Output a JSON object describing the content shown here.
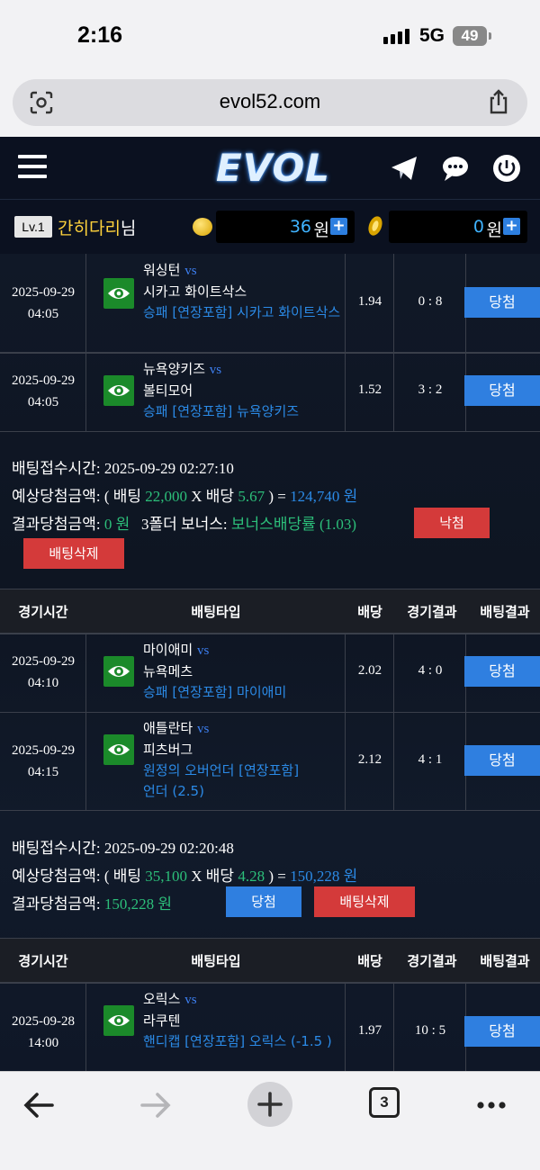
{
  "status": {
    "time": "2:16",
    "network": "5G",
    "battery": "49"
  },
  "browser": {
    "url": "evol52.com",
    "tab_count": "3"
  },
  "header": {
    "logo": "EVOL"
  },
  "user": {
    "level": "Lv.1",
    "name": "간히다리",
    "suffix": "님",
    "balance": "36",
    "balance_unit": "원",
    "points": "0",
    "points_unit": "원"
  },
  "table_headers": {
    "time": "경기시간",
    "type": "배팅타입",
    "odds": "배당",
    "result": "경기결과",
    "bet_result": "배팅결과"
  },
  "slip1": {
    "rows": [
      {
        "date": "2025-09-29",
        "time": "04:05",
        "team1": "워싱턴",
        "vs": "vs",
        "team2": "시카고 화이트삭스",
        "bet": "승패 [연장포함] 시카고 화이트삭스",
        "odds": "1.94",
        "score": "0 : 8",
        "status": "당첨"
      },
      {
        "date": "2025-09-29",
        "time": "04:05",
        "team1": "뉴욕양키즈",
        "vs": "vs",
        "team2": "볼티모어",
        "bet": "승패 [연장포함] 뉴욕양키즈",
        "odds": "1.52",
        "score": "3 : 2",
        "status": "당첨"
      }
    ],
    "accept_label": "배팅접수시간:",
    "accept_time": "2025-09-29 02:27:10",
    "expected_label": "예상당첨금액: ( 배팅",
    "bet_amount": "22,000",
    "x_label": "X 배당",
    "odds_total": "5.67",
    "eq": ") =",
    "expected_amount": "124,740 원",
    "result_label": "결과당첨금액:",
    "result_amount": "0 원",
    "bonus_label": "3폴더 보너스:",
    "bonus_value": "보너스배당률 (1.03)",
    "status_button": "낙첨",
    "delete_button": "배팅삭제"
  },
  "slip2": {
    "rows": [
      {
        "date": "2025-09-29",
        "time": "04:10",
        "team1": "마이애미",
        "vs": "vs",
        "team2": "뉴욕메츠",
        "bet": "승패 [연장포함] 마이애미",
        "odds": "2.02",
        "score": "4 : 0",
        "status": "당첨"
      },
      {
        "date": "2025-09-29",
        "time": "04:15",
        "team1": "애틀란타",
        "vs": "vs",
        "team2": "피츠버그",
        "bet": "원정의 오버언더 [연장포함] 언더 (2.5)",
        "odds": "2.12",
        "score": "4 : 1",
        "status": "당첨"
      }
    ],
    "accept_label": "배팅접수시간:",
    "accept_time": "2025-09-29 02:20:48",
    "expected_label": "예상당첨금액: ( 배팅",
    "bet_amount": "35,100",
    "x_label": "X 배당",
    "odds_total": "4.28",
    "eq": ") =",
    "expected_amount": "150,228 원",
    "result_label": "결과당첨금액:",
    "result_amount": "150,228 원",
    "status_button": "당첨",
    "delete_button": "배팅삭제"
  },
  "slip3": {
    "rows": [
      {
        "date": "2025-09-28",
        "time": "14:00",
        "team1": "오릭스",
        "vs": "vs",
        "team2": "라쿠텐",
        "bet": "핸디캡 [연장포함] 오릭스 (-1.5 )",
        "odds": "1.97",
        "score": "10 : 5",
        "status": "당첨"
      }
    ]
  },
  "colors": {
    "accent": "#2f7fe0",
    "danger": "#d43a3a",
    "green": "#2cbf7a",
    "gold": "#ffd23c"
  }
}
